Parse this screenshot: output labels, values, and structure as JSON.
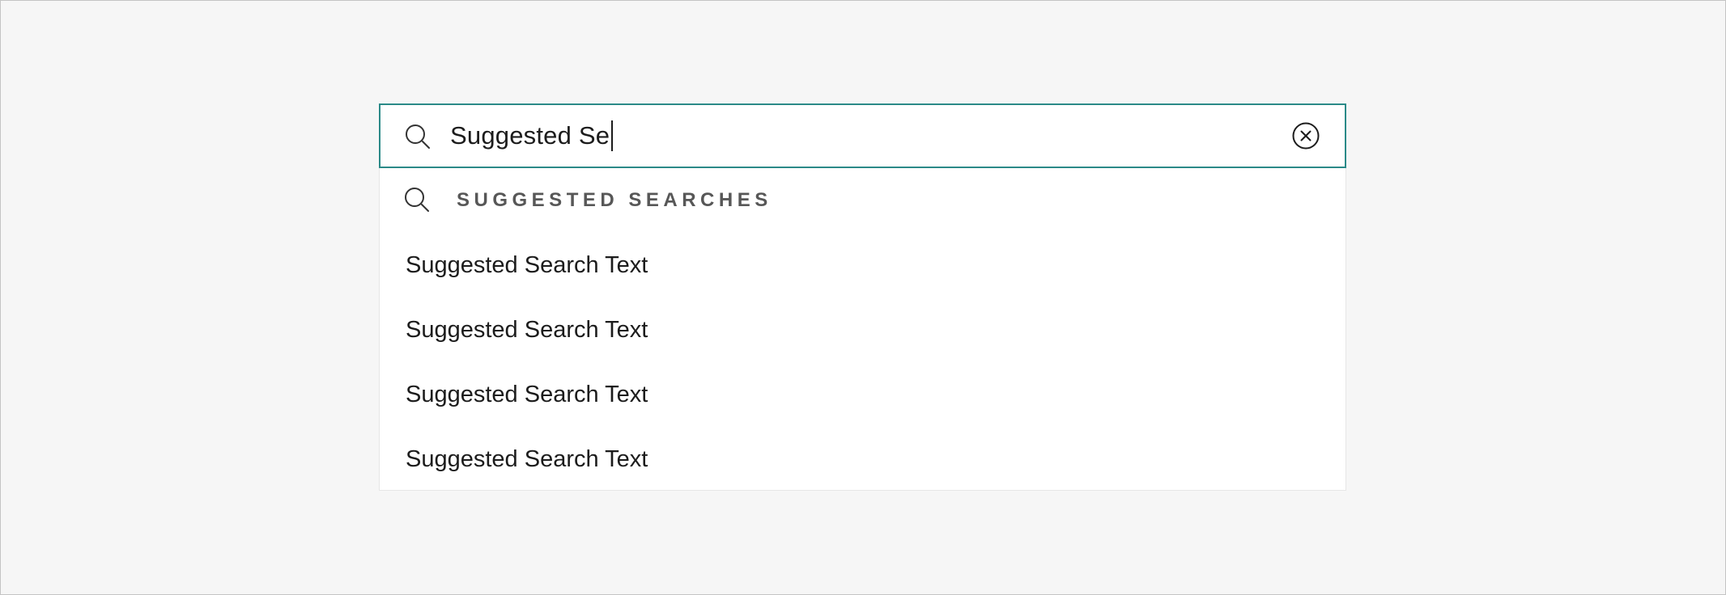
{
  "search": {
    "value": "Suggested Se",
    "clear_label": "Clear search",
    "accent_color": "#2b8a88"
  },
  "dropdown": {
    "header_label": "SUGGESTED SEARCHES",
    "header_icon": "search-icon",
    "items": [
      {
        "label": "Suggested Search Text"
      },
      {
        "label": "Suggested Search Text"
      },
      {
        "label": "Suggested Search Text"
      },
      {
        "label": "Suggested Search Text"
      }
    ]
  },
  "icons": {
    "search": "search-icon",
    "clear": "close-circle-icon"
  }
}
